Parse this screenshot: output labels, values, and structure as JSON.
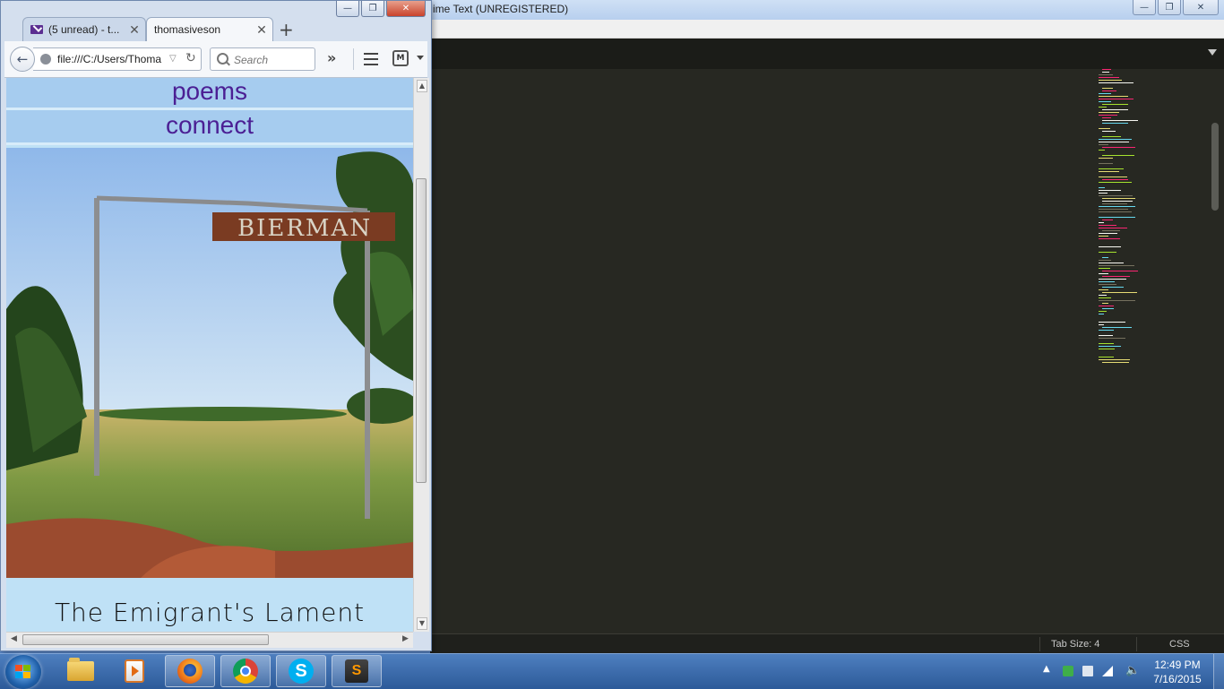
{
  "sublime": {
    "title": "ime Text (UNREGISTERED)",
    "status": {
      "tab_size": "Tab Size: 4",
      "syntax": "CSS"
    }
  },
  "firefox": {
    "tabs": [
      {
        "label": "(5 unread) - t...",
        "icon": "mail-icon"
      },
      {
        "label": "thomasiveson",
        "icon": ""
      }
    ],
    "url": "file:///C:/Users/Thoma",
    "search_placeholder": "Search",
    "page": {
      "nav": [
        "poems",
        "connect"
      ],
      "hero_sign": "BIERMAN",
      "poem_title": "The Emigrant's Lament"
    }
  },
  "taskbar": {
    "apps": [
      "windows-explorer",
      "windows-media-player",
      "firefox",
      "chrome",
      "skype",
      "sublime-text"
    ],
    "active_apps": [
      "firefox",
      "sublime-text"
    ],
    "clock": {
      "time": "12:49 PM",
      "date": "7/16/2015"
    }
  },
  "colors": {
    "nav_text": "#4b1f94",
    "nav_bg": "#a6ccef",
    "page_bg": "#bfe1f6",
    "editor_bg": "#272822",
    "taskbar": "#2c5a99"
  }
}
